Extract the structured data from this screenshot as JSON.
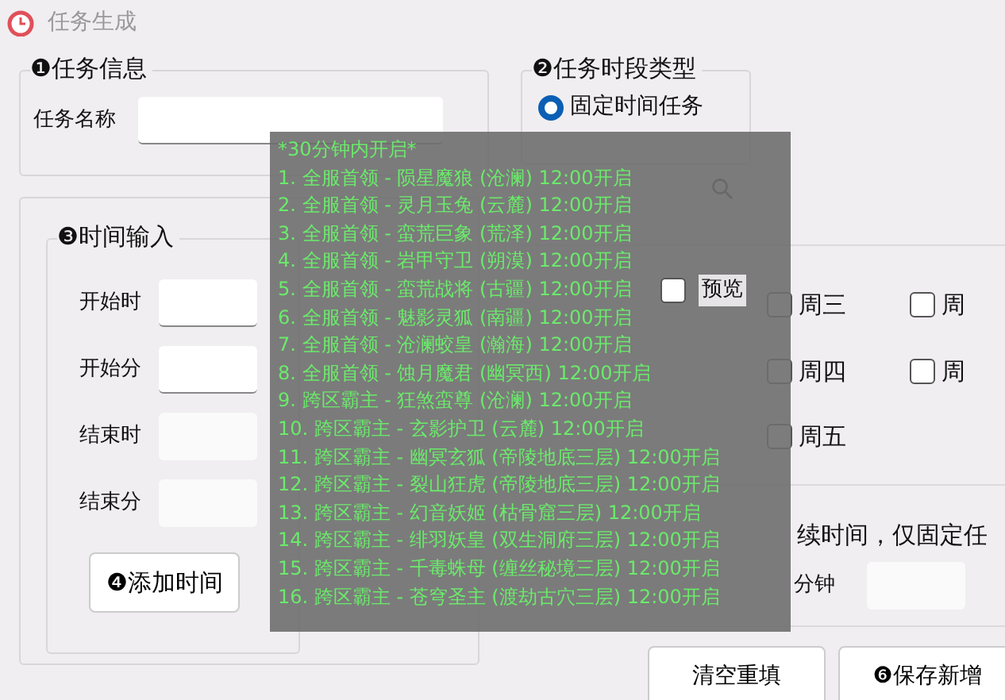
{
  "window": {
    "title": "任务生成"
  },
  "task_info": {
    "title": "❶任务信息",
    "name_label": "任务名称"
  },
  "period_type": {
    "title": "❷任务时段类型",
    "options": [
      {
        "label": "固定时间任务",
        "selected": true
      }
    ]
  },
  "time_input": {
    "title": "❸时间输入",
    "fields": [
      {
        "label": "开始时"
      },
      {
        "label": "开始分"
      },
      {
        "label": "结束时"
      },
      {
        "label": "结束分"
      }
    ],
    "add_button": "❹添加时间"
  },
  "preview": {
    "label": "预览",
    "checked": false
  },
  "weekdays": [
    {
      "label": "周三",
      "checked": false
    },
    {
      "label": "周",
      "checked": false
    },
    {
      "label": "周四",
      "checked": false
    },
    {
      "label": "周",
      "checked": false
    },
    {
      "label": "周五",
      "checked": false
    }
  ],
  "duration": {
    "note": "续时间，仅固定任",
    "unit_label": "分钟"
  },
  "buttons": [
    {
      "label": "清空重填"
    },
    {
      "label": "❻保存新增"
    }
  ],
  "tooltip": {
    "lines": [
      "*30分钟内开启*",
      "1. 全服首领 - 陨星魔狼 (沧澜) 12:00开启",
      "2. 全服首领 - 灵月玉兔 (云麓) 12:00开启",
      "3. 全服首领 - 蛮荒巨象 (荒泽) 12:00开启",
      "4. 全服首领 - 岩甲守卫 (朔漠) 12:00开启",
      "5. 全服首领 - 蛮荒战将 (古疆) 12:00开启",
      "6. 全服首领 - 魅影灵狐 (南疆) 12:00开启",
      "7. 全服首领 - 沧澜蛟皇 (瀚海) 12:00开启",
      "8. 全服首领 - 蚀月魔君 (幽冥西) 12:00开启",
      "9. 跨区霸主 - 狂煞蛮尊 (沧澜) 12:00开启",
      "10. 跨区霸主 - 玄影护卫 (云麓) 12:00开启",
      "11. 跨区霸主 - 幽冥玄狐 (帝陵地底三层) 12:00开启",
      "12. 跨区霸主 - 裂山狂虎 (帝陵地底三层) 12:00开启",
      "13. 跨区霸主 - 幻音妖姬 (枯骨窟三层) 12:00开启",
      "14. 跨区霸主 - 绯羽妖皇 (双生洞府三层) 12:00开启",
      "15. 跨区霸主 - 千毒蛛母 (缠丝秘境三层) 12:00开启",
      "16. 跨区霸主 - 苍穹圣主 (渡劫古穴三层) 12:00开启"
    ]
  }
}
